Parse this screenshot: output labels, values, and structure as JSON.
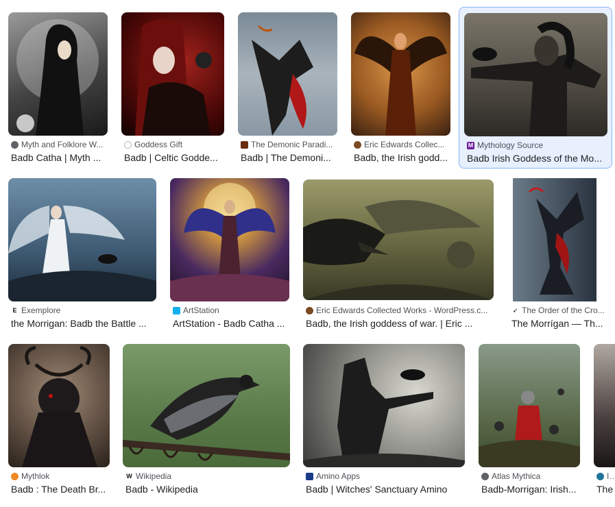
{
  "results": [
    {
      "source": "Myth and Folklore W...",
      "title": "Badb Catha | Myth ...",
      "favicon": "globe-icon"
    },
    {
      "source": "Goddess Gift",
      "title": "Badb | Celtic Godde...",
      "favicon": "goddess-gift-icon"
    },
    {
      "source": "The Demonic Paradi...",
      "title": "Badb | The Demoni...",
      "favicon": "demonic-paradise-icon"
    },
    {
      "source": "Eric Edwards Collec...",
      "title": "Badb, the Irish godd...",
      "favicon": "eric-edwards-icon"
    },
    {
      "source": "Mythology Source",
      "title": "Badb Irish Goddess of the Mo...",
      "favicon": "mythology-source-icon",
      "favicon_letter": "M"
    },
    {
      "source": "Exemplore",
      "title": "the Morrigan: Badb the Battle ...",
      "favicon": "exemplore-icon",
      "favicon_letter": "E"
    },
    {
      "source": "ArtStation",
      "title": "ArtStation - Badb Catha ...",
      "favicon": "artstation-icon"
    },
    {
      "source": "Eric Edwards Collected Works - WordPress.c...",
      "title": "Badb, the Irish goddess of war. | Eric ...",
      "favicon": "eric-edwards-icon"
    },
    {
      "source": "The Order of the Cro...",
      "title": "The Morrígan — Th...",
      "favicon": "crow-icon"
    },
    {
      "source": "Mythlok",
      "title": "Badb : The Death Br...",
      "favicon": "mythlok-icon"
    },
    {
      "source": "Wikipedia",
      "title": "Badb - Wikipedia",
      "favicon": "wikipedia-icon",
      "favicon_letter": "W"
    },
    {
      "source": "Amino Apps",
      "title": "Badb | Witches' Sanctuary Amino",
      "favicon": "amino-icon"
    },
    {
      "source": "Atlas Mythica",
      "title": "Badb-Morrigan: Irish...",
      "favicon": "globe-icon"
    },
    {
      "source": "Ire",
      "title": "The",
      "favicon": "wordpress-icon"
    }
  ],
  "colors": {
    "selected_bg": "#e8f0fe",
    "selected_border": "#8ab4f8",
    "source_text": "#4d5156",
    "title_text": "#202124"
  }
}
